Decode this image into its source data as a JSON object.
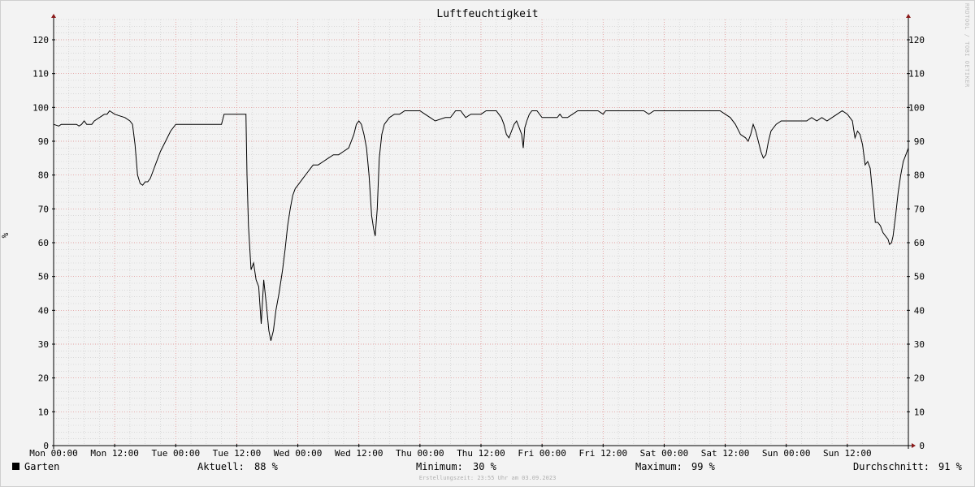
{
  "title": "Luftfeuchtigkeit",
  "watermark": "RRDTOOL / TOBI OETIKER",
  "footer": "Erstellungszeit: 23:55 Uhr am 03.09.2023",
  "colors": {
    "background": "#f3f3f3",
    "line": "#000000",
    "minor_grid": "#c8c8c8",
    "major_grid": "#e48c8c",
    "axis_arrow": "#8b1a1a"
  },
  "legend": {
    "series_name": "Garten",
    "current_label": "Aktuell:",
    "current_value": "88 %",
    "min_label": "Minimum:",
    "min_value": "30 %",
    "max_label": "Maximum:",
    "max_value": "99 %",
    "avg_label": "Durchschnitt:",
    "avg_value": "91 %"
  },
  "chart_data": {
    "type": "line",
    "title": "Luftfeuchtigkeit",
    "ylabel": "%",
    "ylim": [
      0,
      126
    ],
    "xlim": [
      0,
      168
    ],
    "y_ticks": [
      0,
      10,
      20,
      30,
      40,
      50,
      60,
      70,
      80,
      90,
      100,
      110,
      120
    ],
    "x_ticks": [
      {
        "x": 0,
        "label": "Mon 00:00"
      },
      {
        "x": 12,
        "label": "Mon 12:00"
      },
      {
        "x": 24,
        "label": "Tue 00:00"
      },
      {
        "x": 36,
        "label": "Tue 12:00"
      },
      {
        "x": 48,
        "label": "Wed 00:00"
      },
      {
        "x": 60,
        "label": "Wed 12:00"
      },
      {
        "x": 72,
        "label": "Thu 00:00"
      },
      {
        "x": 84,
        "label": "Thu 12:00"
      },
      {
        "x": 96,
        "label": "Fri 00:00"
      },
      {
        "x": 108,
        "label": "Fri 12:00"
      },
      {
        "x": 120,
        "label": "Sat 00:00"
      },
      {
        "x": 132,
        "label": "Sat 12:00"
      },
      {
        "x": 144,
        "label": "Sun 00:00"
      },
      {
        "x": 156,
        "label": "Sun 12:00"
      }
    ],
    "grid": true,
    "legend_position": "bottom",
    "series": [
      {
        "name": "Garten",
        "points": [
          [
            0,
            95
          ],
          [
            1,
            94.5
          ],
          [
            1.5,
            95
          ],
          [
            2,
            95
          ],
          [
            4.5,
            95
          ],
          [
            5,
            94.5
          ],
          [
            5.5,
            95
          ],
          [
            6,
            96
          ],
          [
            6.5,
            95
          ],
          [
            7.5,
            95
          ],
          [
            8,
            96
          ],
          [
            9,
            97
          ],
          [
            10,
            98
          ],
          [
            10.5,
            98
          ],
          [
            11,
            99
          ],
          [
            12,
            98
          ],
          [
            13,
            97.5
          ],
          [
            14,
            97
          ],
          [
            15,
            96
          ],
          [
            15.5,
            95
          ],
          [
            16,
            89
          ],
          [
            16.5,
            80
          ],
          [
            17,
            77.5
          ],
          [
            17.5,
            77
          ],
          [
            18,
            78
          ],
          [
            18.5,
            78
          ],
          [
            19,
            79
          ],
          [
            19.5,
            81
          ],
          [
            20,
            83
          ],
          [
            21,
            87
          ],
          [
            22,
            90
          ],
          [
            23,
            93
          ],
          [
            24,
            95
          ],
          [
            26,
            95
          ],
          [
            28,
            95
          ],
          [
            30,
            95
          ],
          [
            32,
            95
          ],
          [
            33,
            95
          ],
          [
            33.5,
            98
          ],
          [
            35,
            98
          ],
          [
            37,
            98
          ],
          [
            37.8,
            98
          ],
          [
            38,
            80
          ],
          [
            38.3,
            65
          ],
          [
            38.8,
            52
          ],
          [
            39.3,
            54
          ],
          [
            39.8,
            49
          ],
          [
            40.3,
            47
          ],
          [
            40.8,
            36
          ],
          [
            41.3,
            49
          ],
          [
            41.8,
            42
          ],
          [
            42.3,
            34
          ],
          [
            42.7,
            31
          ],
          [
            43.2,
            34
          ],
          [
            43.7,
            40
          ],
          [
            44.3,
            45
          ],
          [
            45,
            52
          ],
          [
            45.5,
            58
          ],
          [
            46,
            65
          ],
          [
            46.5,
            70
          ],
          [
            47,
            74
          ],
          [
            47.5,
            76
          ],
          [
            48,
            77
          ],
          [
            49,
            79
          ],
          [
            50,
            81
          ],
          [
            51,
            83
          ],
          [
            52,
            83
          ],
          [
            53,
            84
          ],
          [
            54,
            85
          ],
          [
            55,
            86
          ],
          [
            56,
            86
          ],
          [
            57,
            87
          ],
          [
            58,
            88
          ],
          [
            59,
            92
          ],
          [
            59.5,
            95
          ],
          [
            60,
            96
          ],
          [
            60.5,
            95
          ],
          [
            61,
            92
          ],
          [
            61.5,
            88
          ],
          [
            62,
            80
          ],
          [
            62.5,
            68
          ],
          [
            62.9,
            64
          ],
          [
            63.2,
            62
          ],
          [
            63.6,
            70
          ],
          [
            64,
            85
          ],
          [
            64.5,
            92
          ],
          [
            65,
            95
          ],
          [
            66,
            97
          ],
          [
            67,
            98
          ],
          [
            68,
            98
          ],
          [
            69,
            99
          ],
          [
            70,
            99
          ],
          [
            71,
            99
          ],
          [
            72,
            99
          ],
          [
            73,
            98
          ],
          [
            74,
            97
          ],
          [
            75,
            96
          ],
          [
            77,
            97
          ],
          [
            78,
            97
          ],
          [
            79,
            99
          ],
          [
            80,
            99
          ],
          [
            81,
            97
          ],
          [
            82,
            98
          ],
          [
            84,
            98
          ],
          [
            85,
            99
          ],
          [
            86,
            99
          ],
          [
            87,
            99
          ],
          [
            88,
            97
          ],
          [
            88.5,
            95
          ],
          [
            89,
            92
          ],
          [
            89.5,
            91
          ],
          [
            90,
            93
          ],
          [
            90.5,
            95
          ],
          [
            91,
            96
          ],
          [
            91.5,
            94
          ],
          [
            92,
            92
          ],
          [
            92.3,
            88
          ],
          [
            92.6,
            94
          ],
          [
            93,
            96
          ],
          [
            93.5,
            98
          ],
          [
            94,
            99
          ],
          [
            95,
            99
          ],
          [
            96,
            97
          ],
          [
            97,
            97
          ],
          [
            98,
            97
          ],
          [
            99,
            97
          ],
          [
            99.5,
            98
          ],
          [
            100,
            97
          ],
          [
            101,
            97
          ],
          [
            102,
            98
          ],
          [
            103,
            99
          ],
          [
            105,
            99
          ],
          [
            107,
            99
          ],
          [
            108,
            98
          ],
          [
            108.5,
            99
          ],
          [
            110,
            99
          ],
          [
            112,
            99
          ],
          [
            114,
            99
          ],
          [
            116,
            99
          ],
          [
            117,
            98
          ],
          [
            118,
            99
          ],
          [
            120,
            99
          ],
          [
            122,
            99
          ],
          [
            124,
            99
          ],
          [
            126,
            99
          ],
          [
            128,
            99
          ],
          [
            130,
            99
          ],
          [
            131,
            99
          ],
          [
            132,
            98
          ],
          [
            133,
            97
          ],
          [
            134,
            95
          ],
          [
            135,
            92
          ],
          [
            136,
            91
          ],
          [
            136.5,
            90
          ],
          [
            137,
            92
          ],
          [
            137.5,
            95
          ],
          [
            138,
            93
          ],
          [
            138.5,
            90
          ],
          [
            139,
            87
          ],
          [
            139.5,
            85
          ],
          [
            140,
            86
          ],
          [
            140.5,
            90
          ],
          [
            141,
            93
          ],
          [
            142,
            95
          ],
          [
            143,
            96
          ],
          [
            144,
            96
          ],
          [
            146,
            96
          ],
          [
            148,
            96
          ],
          [
            149,
            97
          ],
          [
            150,
            96
          ],
          [
            151,
            97
          ],
          [
            152,
            96
          ],
          [
            153,
            97
          ],
          [
            154,
            98
          ],
          [
            155,
            99
          ],
          [
            156,
            98
          ],
          [
            156.5,
            97
          ],
          [
            157,
            96
          ],
          [
            157.5,
            91
          ],
          [
            158,
            93
          ],
          [
            158.5,
            92
          ],
          [
            159,
            89
          ],
          [
            159.5,
            83
          ],
          [
            160,
            84
          ],
          [
            160.5,
            82
          ],
          [
            161,
            74
          ],
          [
            161.5,
            66
          ],
          [
            162,
            66
          ],
          [
            162.5,
            65
          ],
          [
            163,
            63
          ],
          [
            163.5,
            62
          ],
          [
            164,
            61
          ],
          [
            164.3,
            59.5
          ],
          [
            164.7,
            60
          ],
          [
            165,
            62
          ],
          [
            165.5,
            68
          ],
          [
            166,
            75
          ],
          [
            166.5,
            80
          ],
          [
            167,
            84
          ],
          [
            167.5,
            86
          ],
          [
            168,
            88
          ]
        ]
      }
    ]
  }
}
